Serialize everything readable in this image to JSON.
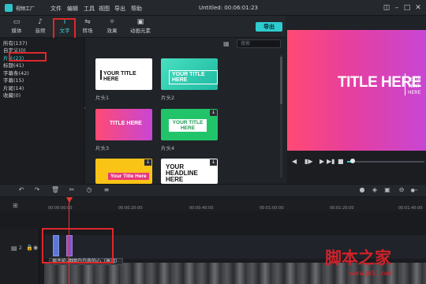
{
  "app": {
    "name": "视频工厂",
    "window_title": "Untitled: 00:06:01:23"
  },
  "menu": [
    "文件",
    "编辑",
    "工具",
    "视图",
    "导出",
    "帮助"
  ],
  "tools": [
    {
      "icon": "folder-icon",
      "label": "媒体"
    },
    {
      "icon": "music-icon",
      "label": "音频"
    },
    {
      "icon": "text-icon",
      "label": "文字"
    },
    {
      "icon": "transition-icon",
      "label": "转场"
    },
    {
      "icon": "effects-icon",
      "label": "效果"
    },
    {
      "icon": "image-icon",
      "label": "动画元素"
    }
  ],
  "export_label": "导出",
  "categories": [
    "所有(137)",
    "自定义(0)",
    "片头(23)",
    "标题(41)",
    "字幕条(42)",
    "字幕(15)",
    "片尾(14)",
    "收藏(0)"
  ],
  "selected_category": "片头(23)",
  "search_placeholder": "搜索",
  "thumbnails": [
    {
      "label": "片头1",
      "text": "YOUR TITLE HERE"
    },
    {
      "label": "片头2",
      "text": "YOUR TITLE HERE"
    },
    {
      "label": "片头3",
      "text": "TITLE HERE"
    },
    {
      "label": "片头4",
      "text": "YOUR TITLE HERE"
    },
    {
      "label": "",
      "text": "Your Title Here"
    },
    {
      "label": "",
      "text": "YOUR HEADLINE HERE"
    }
  ],
  "preview": {
    "title": "TITLE HERE",
    "subtitle": "YOUR TEXT HERE"
  },
  "timeline": {
    "timecodes": [
      "00:00:00:00",
      "00:00:20:00",
      "00:00:40:00",
      "00:01:00:00",
      "00:01:20:00",
      "00:01:40:00"
    ],
    "track_number": "2",
    "clip_tooltip": "周杰伦-明明白白我的心（高清）"
  },
  "watermark": {
    "text": "脚本之家",
    "url": "www.jb51.net"
  },
  "colors": {
    "accent": "#2ec4c7",
    "highlight": "#e0272b",
    "playhead": "#e53935"
  }
}
